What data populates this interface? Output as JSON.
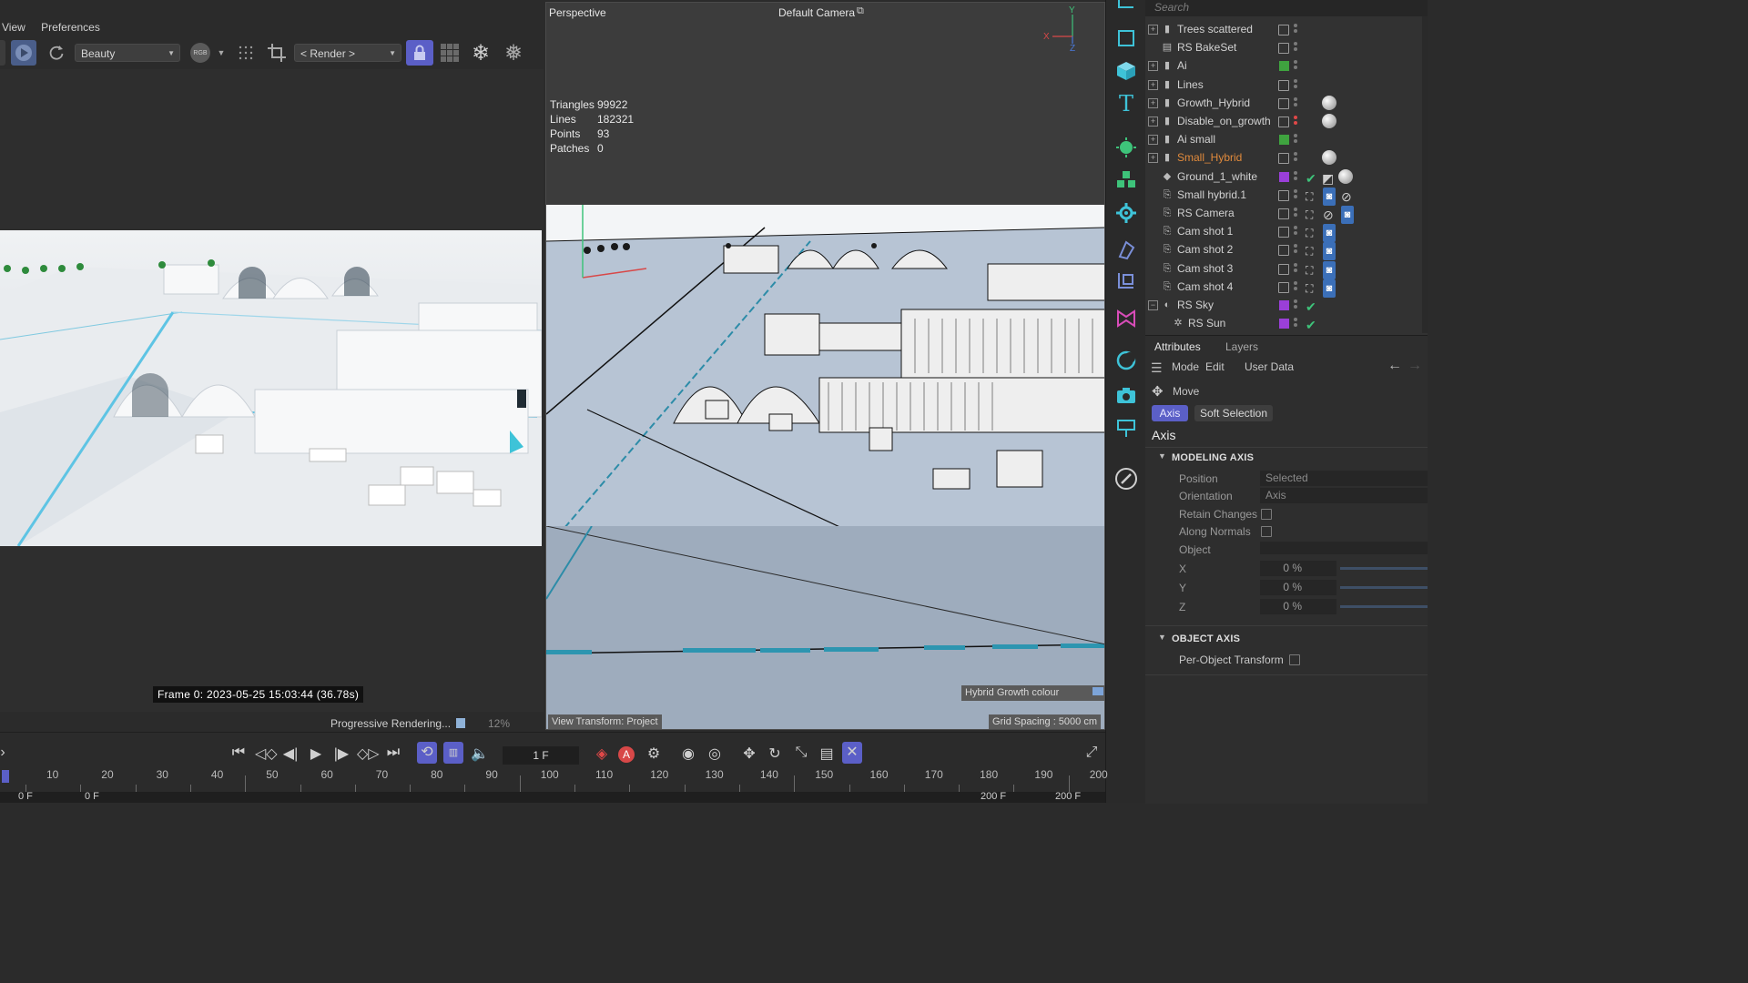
{
  "render_view": {
    "menu": [
      "View",
      "Preferences"
    ],
    "aov_select": "Beauty",
    "color_mode": "RGB",
    "render_select": "< Render >",
    "frame_info": "Frame  0:  2023-05-25  15:03:44  (36.78s)",
    "progress_label": "Progressive Rendering...",
    "progress_pct": "12%",
    "progress_value": 0.12
  },
  "viewport": {
    "view_name": "Perspective",
    "camera_label": "Default Camera",
    "axis_x": "X",
    "axis_y": "Y",
    "axis_z": "Z",
    "stats": [
      {
        "label": "Triangles",
        "value": "99922"
      },
      {
        "label": "Lines",
        "value": "182321"
      },
      {
        "label": "Points",
        "value": "93"
      },
      {
        "label": "Patches",
        "value": "0"
      }
    ],
    "hybrid_tag": "Hybrid Growth colour",
    "view_transform": "View Transform: Project",
    "grid_spacing": "Grid Spacing : 5000 cm"
  },
  "object_manager": {
    "search_placeholder": "Search",
    "objects": [
      {
        "name": "Trees scattered",
        "expand": "+",
        "icon": "null-icon",
        "layer": "none",
        "name_color": "#d2d2d2"
      },
      {
        "name": "RS BakeSet",
        "expand": "",
        "icon": "bakeset-icon",
        "layer": "none",
        "name_color": "#d2d2d2"
      },
      {
        "name": "Ai",
        "expand": "+",
        "icon": "null-icon",
        "layer": "#3fa33f",
        "name_color": "#d2d2d2"
      },
      {
        "name": "Lines",
        "expand": "+",
        "icon": "null-icon",
        "layer": "none",
        "name_color": "#d2d2d2"
      },
      {
        "name": "Growth_Hybrid",
        "expand": "+",
        "icon": "null-icon",
        "layer": "none",
        "name_color": "#d2d2d2",
        "tag": "material"
      },
      {
        "name": "Disable_on_growth",
        "expand": "+",
        "icon": "null-red-icon",
        "layer": "none",
        "name_color": "#d2d2d2",
        "tag": "material",
        "red_dot": true
      },
      {
        "name": "Ai small",
        "expand": "+",
        "icon": "null-icon",
        "layer": "#3fa33f",
        "name_color": "#d2d2d2"
      },
      {
        "name": "Small_Hybrid",
        "expand": "+",
        "icon": "null-green-icon",
        "layer": "none",
        "name_color": "#e08a3c",
        "tag": "material"
      },
      {
        "name": "Ground_1_white",
        "expand": "",
        "icon": "plane-icon",
        "layer": "#9a3fd8",
        "name_color": "#d2d2d2",
        "check": true,
        "tag": "material2"
      },
      {
        "name": "Small hybrid.1",
        "expand": "",
        "icon": "camera-icon",
        "layer": "none",
        "name_color": "#d2d2d2",
        "cam": true,
        "tags": [
          "camera-tag-icon",
          "disable-icon"
        ]
      },
      {
        "name": "RS Camera",
        "expand": "",
        "icon": "camera-icon",
        "layer": "none",
        "name_color": "#d2d2d2",
        "cam": true,
        "tags": [
          "disable-icon",
          "camera-tag-icon"
        ]
      },
      {
        "name": "Cam shot 1",
        "expand": "",
        "icon": "camera-icon",
        "layer": "none",
        "name_color": "#d2d2d2",
        "cam": true,
        "tags": [
          "camera-tag-icon"
        ]
      },
      {
        "name": "Cam shot 2",
        "expand": "",
        "icon": "camera-icon",
        "layer": "none",
        "name_color": "#d2d2d2",
        "cam": true,
        "tags": [
          "camera-tag-icon"
        ]
      },
      {
        "name": "Cam shot 3",
        "expand": "",
        "icon": "camera-icon",
        "layer": "none",
        "name_color": "#d2d2d2",
        "cam": true,
        "tags": [
          "camera-tag-icon"
        ]
      },
      {
        "name": "Cam shot 4",
        "expand": "",
        "icon": "camera-icon",
        "layer": "none",
        "name_color": "#d2d2d2",
        "cam": true,
        "tags": [
          "camera-tag-icon"
        ]
      },
      {
        "name": "RS Sky",
        "expand": "-",
        "icon": "sky-icon",
        "layer": "#9a3fd8",
        "name_color": "#d2d2d2",
        "check": true
      },
      {
        "name": "RS Sun",
        "expand": "",
        "icon": "sun-icon",
        "layer": "#9a3fd8",
        "name_color": "#d2d2d2",
        "check": true,
        "indent": true
      }
    ]
  },
  "attributes": {
    "tabs": [
      "Attributes",
      "Layers"
    ],
    "menu": [
      "Mode",
      "Edit",
      "User Data"
    ],
    "tool": "Move",
    "subtabs": [
      "Axis",
      "Soft Selection"
    ],
    "section_title": "Axis",
    "modeling_axis": {
      "heading": "MODELING AXIS",
      "position_label": "Position",
      "position_value": "Selected",
      "orientation_label": "Orientation",
      "orientation_value": "Axis",
      "retain_label": "Retain Changes",
      "normals_label": "Along Normals",
      "object_label": "Object",
      "x_label": "X",
      "x_value": "0 %",
      "y_label": "Y",
      "y_value": "0 %",
      "z_label": "Z",
      "z_value": "0 %"
    },
    "object_axis": {
      "heading": "OBJECT AXIS",
      "per_object_label": "Per-Object Transform"
    }
  },
  "timeline": {
    "current_frame": "1 F",
    "ticks": [
      "10",
      "20",
      "30",
      "40",
      "50",
      "60",
      "70",
      "80",
      "90",
      "100",
      "110",
      "120",
      "130",
      "140",
      "150",
      "160",
      "170",
      "180",
      "190",
      "200"
    ],
    "start_a": "0 F",
    "start_b": "0 F",
    "end_a": "200 F",
    "end_b": "200 F"
  },
  "colors": {
    "accent": "#5b5fc7",
    "layer_green": "#3fa33f",
    "layer_purple": "#9a3fd8",
    "highlight_orange": "#e08a3c",
    "icon_teal": "#3ec3d8"
  }
}
